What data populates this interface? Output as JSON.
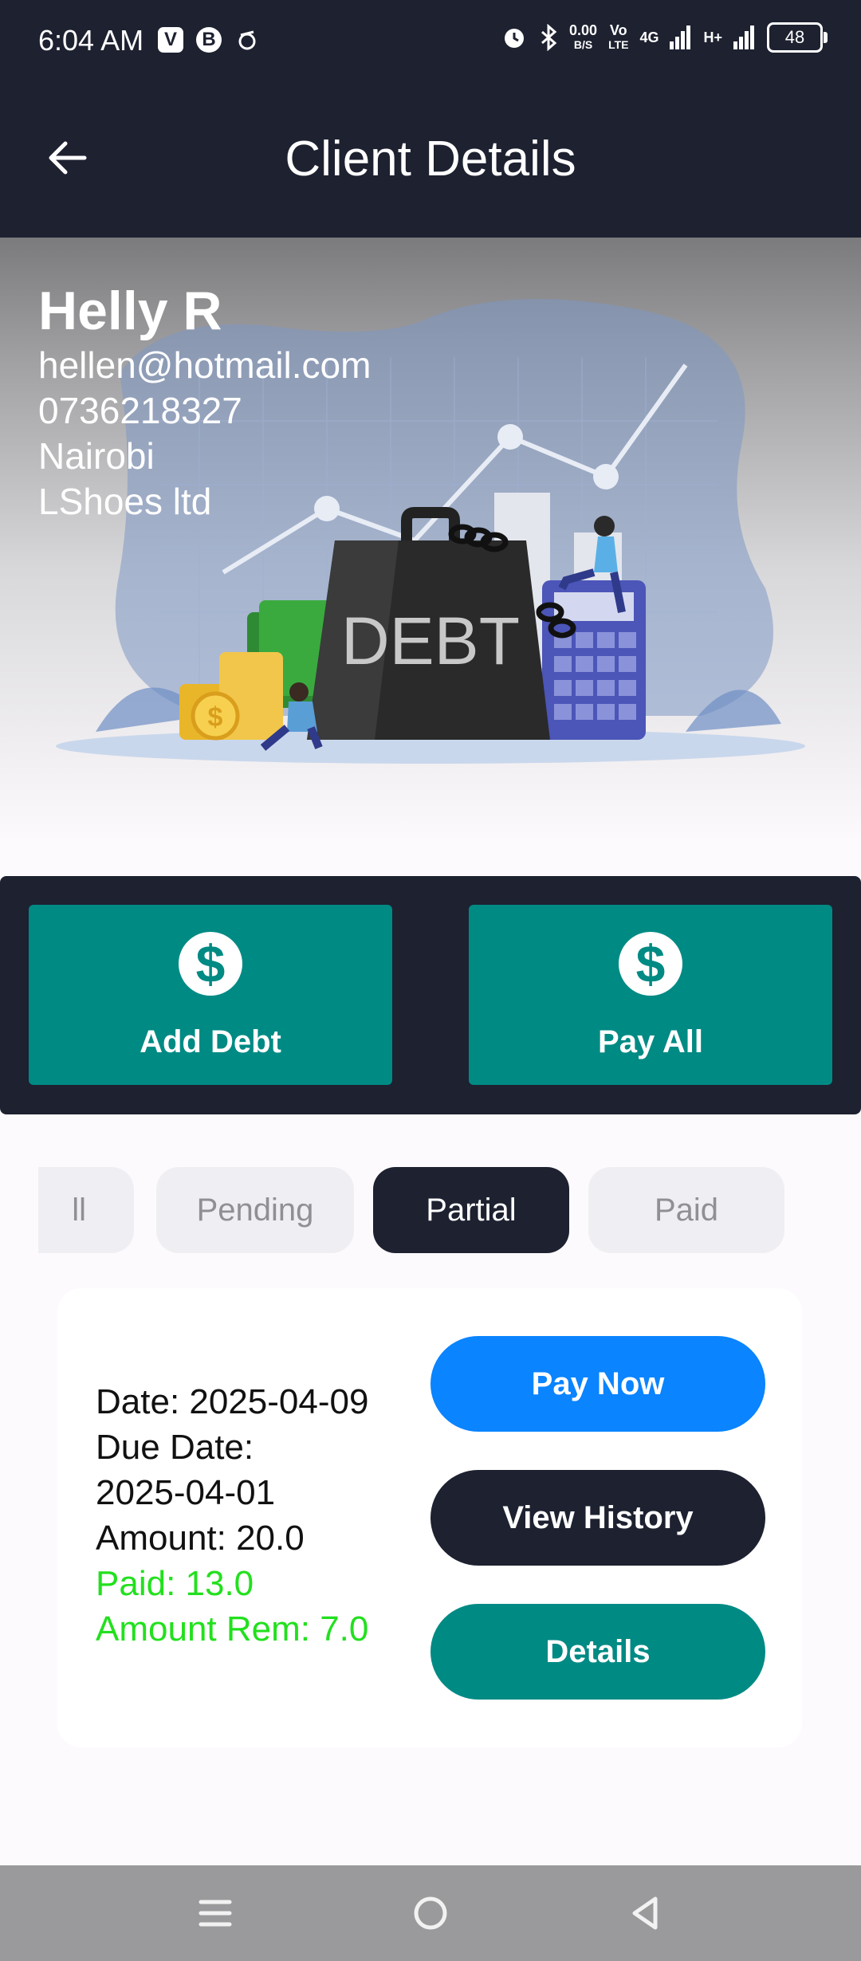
{
  "status_bar": {
    "time": "6:04 AM",
    "left_icons": [
      "v-app-icon",
      "b-app-icon",
      "fan-icon"
    ],
    "right_icons": [
      "alarm-icon",
      "bluetooth-icon",
      "signal-icon",
      "signal-icon"
    ],
    "data_speed": "0.00",
    "data_unit": "B/S",
    "volte_top": "Vo",
    "volte_bottom": "LTE",
    "network_4g": "4G",
    "network_h": "H+",
    "battery": "48"
  },
  "header": {
    "title": "Client Details",
    "back_icon": "arrow-left-icon"
  },
  "client": {
    "name": "Helly R",
    "email": "hellen@hotmail.com",
    "phone": "0736218327",
    "city": "Nairobi",
    "company": "LShoes ltd"
  },
  "hero": {
    "illustration_text": "DEBT"
  },
  "actions": {
    "add_debt": {
      "label": "Add Debt",
      "icon": "dollar-icon"
    },
    "pay_all": {
      "label": "Pay All",
      "icon": "dollar-icon"
    }
  },
  "filters": {
    "items": [
      "All",
      "Pending",
      "Partial",
      "Paid"
    ],
    "visible_first": "ll",
    "active": "Partial"
  },
  "debt": {
    "date": "Date: 2025-04-09",
    "due_label": "Due Date:",
    "due_value": "2025-04-01",
    "amount": "Amount: 20.0",
    "paid": "Paid: 13.0",
    "remaining": "Amount Rem: 7.0",
    "buttons": {
      "pay_now": "Pay Now",
      "view_history": "View History",
      "details": "Details"
    }
  },
  "colors": {
    "dark": "#1d2130",
    "teal": "#008a84",
    "blue": "#0a84ff",
    "green": "#22e01e"
  }
}
